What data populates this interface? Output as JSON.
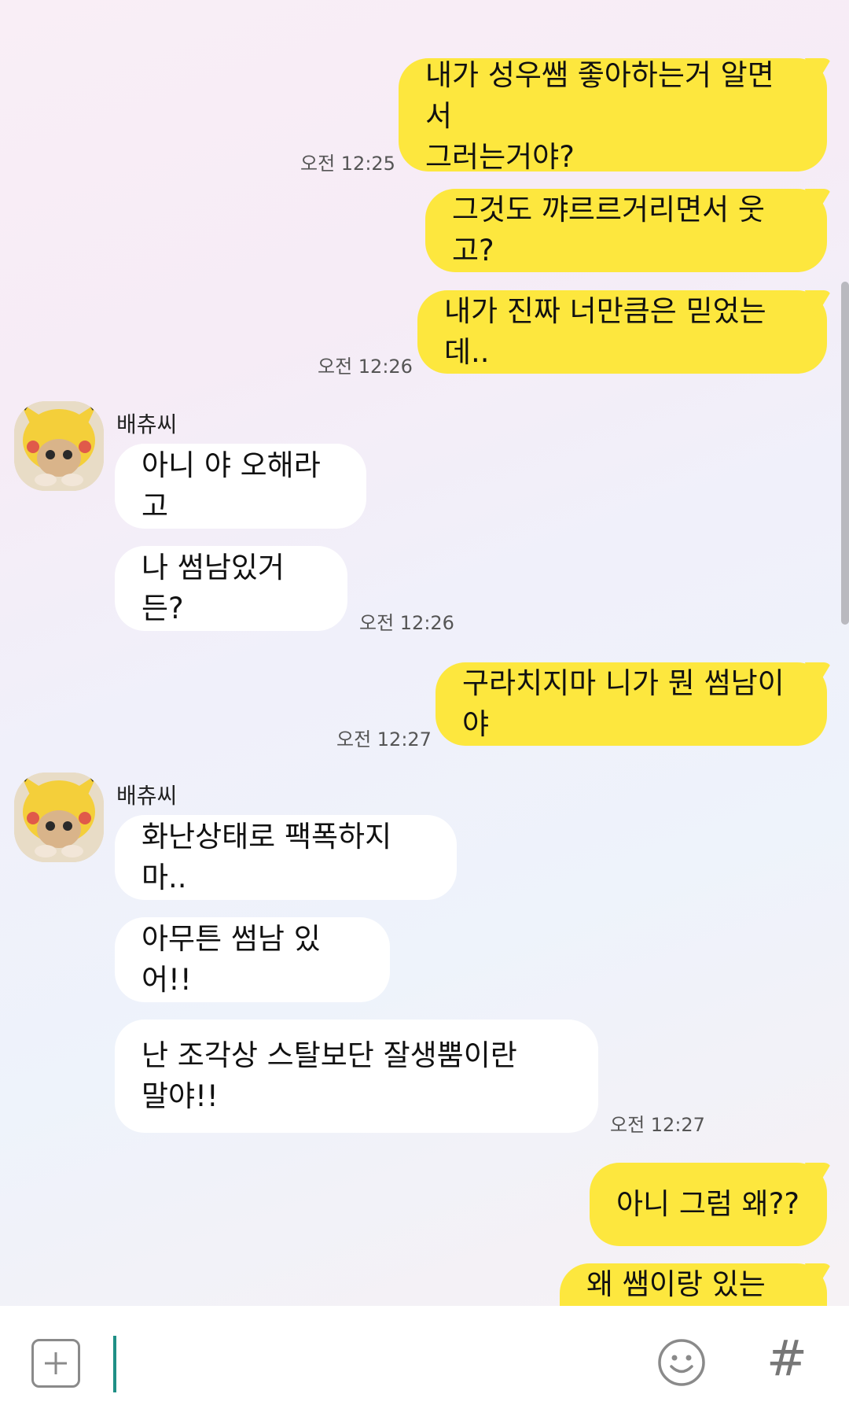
{
  "messages": [
    {
      "text": "내가 성우쌤 좋아하는거 알면서\n그러는거야?"
    },
    {
      "text": "그것도 꺄르르거리면서 웃고?"
    },
    {
      "text": "내가 진짜 너만큼은 믿었는데.."
    },
    {
      "text": "아니 야 오해라고"
    },
    {
      "text": "나 썸남있거든?"
    },
    {
      "text": "구라치지마 니가 뭔 썸남이야"
    },
    {
      "text": "화난상태로 팩폭하지마.."
    },
    {
      "text": "아무튼 썸남 있어!!"
    },
    {
      "text": "난 조각상 스탈보단 잘생뿜이란\n말야!!"
    },
    {
      "text": "아니 그럼 왜??"
    },
    {
      "text": "왜 쌤이랑 있는데?"
    }
  ],
  "times": [
    "오전 12:25",
    "오전 12:26",
    "오전 12:26",
    "오전 12:27",
    "오전 12:27"
  ],
  "contact": {
    "name": "배츄씨",
    "avatar_icon": "pikachu-cat-avatar"
  },
  "input": {
    "placeholder": ""
  },
  "icons": {
    "add": "plus-square-icon",
    "emoji": "smiley-icon",
    "hashtag": "hash-icon"
  },
  "colors": {
    "my_bubble": "#fde73e",
    "their_bubble": "#ffffff",
    "cursor": "#1f8f86"
  }
}
